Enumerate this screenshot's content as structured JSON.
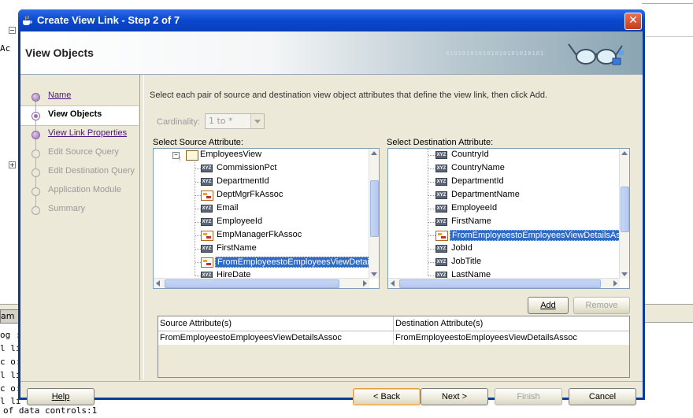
{
  "background": {
    "lines": [
      "og :",
      "l li",
      "c o:",
      "l li",
      "c o:",
      "l li"
    ],
    "last_line": "of data controls:1",
    "tab_label": "am",
    "left_text": "Ac"
  },
  "dialog": {
    "title": "Create View Link - Step 2 of 7",
    "close_symbol": "✕",
    "header_title": "View Objects",
    "binary_text": "010101010101010101010101",
    "instruction": "Select each pair of source and destination view object attributes that define the view link, then click Add."
  },
  "nav": {
    "items": [
      {
        "label": "Name",
        "state": "link"
      },
      {
        "label": "View Objects",
        "state": "current"
      },
      {
        "label": "View Link Properties",
        "state": "link"
      },
      {
        "label": "Edit Source Query",
        "state": "disabled"
      },
      {
        "label": "Edit Destination Query",
        "state": "disabled"
      },
      {
        "label": "Application Module",
        "state": "disabled"
      },
      {
        "label": "Summary",
        "state": "disabled"
      }
    ]
  },
  "cardinality": {
    "label": "Cardinality:",
    "value": "1 to *"
  },
  "source": {
    "label": "Select Source Attribute:",
    "root": "EmployeesView",
    "items": [
      {
        "label": "CommissionPct",
        "icon": "attribute"
      },
      {
        "label": "DepartmentId",
        "icon": "attribute"
      },
      {
        "label": "DeptMgrFkAssoc",
        "icon": "association"
      },
      {
        "label": "Email",
        "icon": "attribute"
      },
      {
        "label": "EmployeeId",
        "icon": "attribute"
      },
      {
        "label": "EmpManagerFkAssoc",
        "icon": "association"
      },
      {
        "label": "FirstName",
        "icon": "attribute"
      },
      {
        "label": "FromEmployeestoEmployeesViewDetailsA",
        "icon": "association",
        "selected": true
      },
      {
        "label": "HireDate",
        "icon": "attribute"
      }
    ]
  },
  "destination": {
    "label": "Select Destination Attribute:",
    "items": [
      {
        "label": "CountryId",
        "icon": "attribute"
      },
      {
        "label": "CountryName",
        "icon": "attribute"
      },
      {
        "label": "DepartmentId",
        "icon": "attribute"
      },
      {
        "label": "DepartmentName",
        "icon": "attribute"
      },
      {
        "label": "EmployeeId",
        "icon": "attribute"
      },
      {
        "label": "FirstName",
        "icon": "attribute"
      },
      {
        "label": "FromEmployeestoEmployeesViewDetailsAsso",
        "icon": "association",
        "selected": true
      },
      {
        "label": "JobId",
        "icon": "attribute"
      },
      {
        "label": "JobTitle",
        "icon": "attribute"
      },
      {
        "label": "LastName",
        "icon": "attribute"
      }
    ]
  },
  "buttons": {
    "add": "Add",
    "remove": "Remove",
    "help": "Help",
    "back": "< Back",
    "next": "Next >",
    "finish": "Finish",
    "cancel": "Cancel"
  },
  "table": {
    "headers": [
      "Source Attribute(s)",
      "Destination Attribute(s)"
    ],
    "rows": [
      [
        "FromEmployeestoEmployeesViewDetailsAssoc",
        "FromEmployeestoEmployeesViewDetailsAssoc"
      ]
    ]
  },
  "icon_text": "XYZ"
}
